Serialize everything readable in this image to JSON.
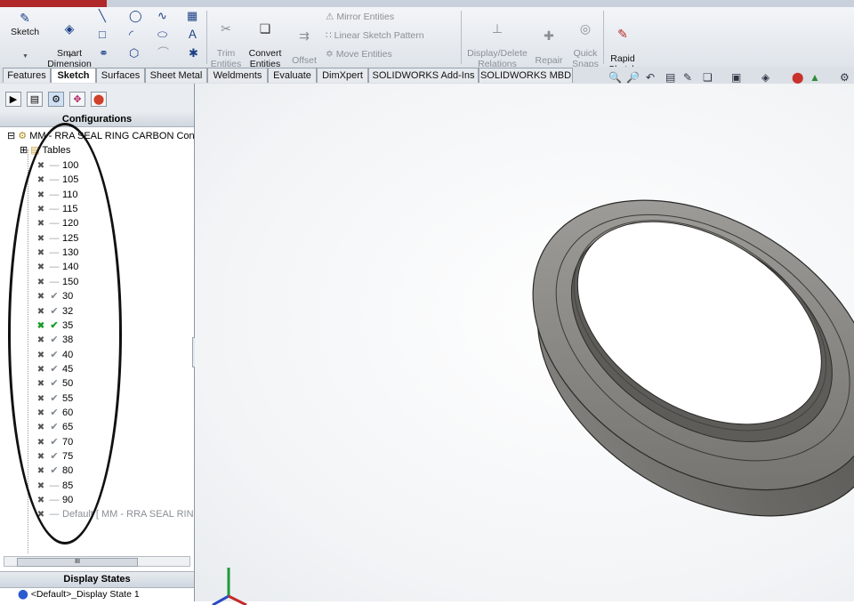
{
  "ribbon": {
    "sketch_label": "Sketch",
    "smart_dimension_label": "Smart\nDimension",
    "trim_label": "Trim\nEntities",
    "convert_label": "Convert\nEntities",
    "offset_label": "Offset\nEntities",
    "mirror_label": "Mirror Entities",
    "linear_pattern_label": "Linear Sketch Pattern",
    "move_label": "Move Entities",
    "display_delete_label": "Display/Delete\nRelations",
    "repair_label": "Repair\nSketch",
    "quick_snaps_label": "Quick\nSnaps",
    "rapid_sketch_label": "Rapid\nSketch"
  },
  "tabs": [
    "Features",
    "Sketch",
    "Surfaces",
    "Sheet Metal",
    "Weldments",
    "Evaluate",
    "DimXpert",
    "SOLIDWORKS Add-Ins",
    "SOLIDWORKS MBD"
  ],
  "active_tab": "Sketch",
  "panel": {
    "header": "Configurations",
    "root_label": "MM - RRA SEAL RING CARBON Conf",
    "tables_label": "Tables",
    "configs": [
      {
        "label": "100",
        "state": "dash"
      },
      {
        "label": "105",
        "state": "dash"
      },
      {
        "label": "110",
        "state": "dash"
      },
      {
        "label": "115",
        "state": "dash"
      },
      {
        "label": "120",
        "state": "dash"
      },
      {
        "label": "125",
        "state": "dash"
      },
      {
        "label": "130",
        "state": "dash"
      },
      {
        "label": "140",
        "state": "dash"
      },
      {
        "label": "150",
        "state": "dash"
      },
      {
        "label": "30",
        "state": "check"
      },
      {
        "label": "32",
        "state": "check"
      },
      {
        "label": "35",
        "state": "active"
      },
      {
        "label": "38",
        "state": "check"
      },
      {
        "label": "40",
        "state": "check"
      },
      {
        "label": "45",
        "state": "check"
      },
      {
        "label": "50",
        "state": "check"
      },
      {
        "label": "55",
        "state": "check"
      },
      {
        "label": "60",
        "state": "check"
      },
      {
        "label": "65",
        "state": "check"
      },
      {
        "label": "70",
        "state": "check"
      },
      {
        "label": "75",
        "state": "check"
      },
      {
        "label": "80",
        "state": "check"
      },
      {
        "label": "85",
        "state": "dash"
      },
      {
        "label": "90",
        "state": "dash"
      },
      {
        "label": "Default [ MM - RRA SEAL RING",
        "state": "dash"
      }
    ],
    "scroll_thumb_label": "III",
    "display_states_header": "Display States",
    "display_state_label": "<Default>_Display State 1"
  },
  "colors": {
    "ribbon_bg": "#e6eaef",
    "active_config": "#18a02a",
    "model_gray": "#6c6a66"
  },
  "icons": [
    "sketch-icon",
    "smart-dimension-icon",
    "line-icon",
    "rectangle-icon",
    "circle-icon",
    "arc-icon",
    "spline-icon",
    "slot-icon",
    "ellipse-icon",
    "text-icon",
    "trim-icon",
    "convert-icon",
    "offset-icon",
    "mirror-icon",
    "pattern-icon",
    "move-icon",
    "relations-icon",
    "repair-icon",
    "snaps-icon",
    "rapid-sketch-icon",
    "triad-icon"
  ]
}
